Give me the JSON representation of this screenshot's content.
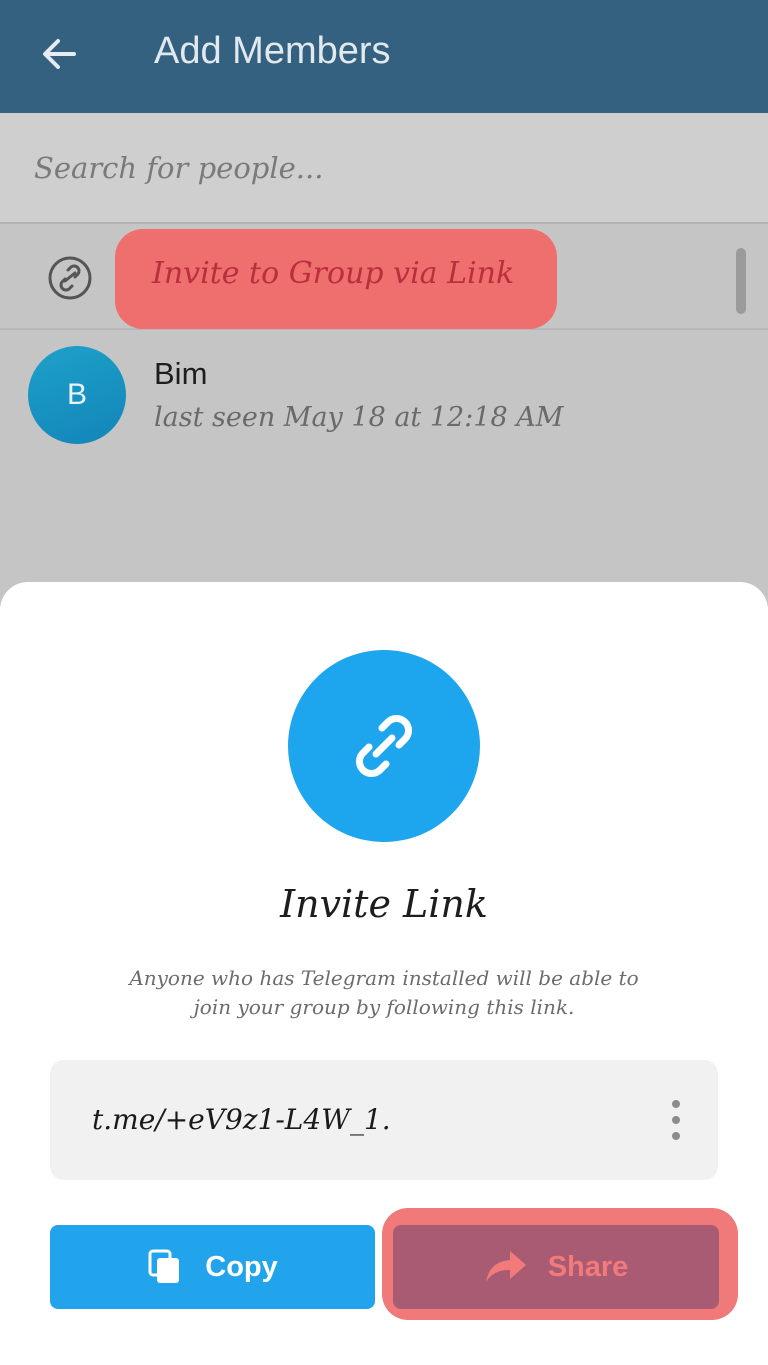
{
  "header": {
    "title": "Add Members",
    "back_icon": "arrow-left-icon"
  },
  "search": {
    "placeholder": "Search for people..."
  },
  "list": {
    "invite_label": "Invite to Group via Link",
    "invite_icon": "link-icon",
    "contacts": [
      {
        "initial": "B",
        "name": "Bim",
        "status": "last seen May 18 at 12:18 AM"
      }
    ]
  },
  "sheet": {
    "icon": "link-icon",
    "title": "Invite Link",
    "description": "Anyone who has Telegram installed will be able to join your group by following this link.",
    "link": "t.me/+eV9z1-L4W_1.",
    "more_icon": "more-vertical-icon",
    "copy_label": "Copy",
    "copy_icon": "copy-icon",
    "share_label": "Share",
    "share_icon": "share-arrow-icon"
  },
  "colors": {
    "header_bg": "#33617f",
    "accent_blue": "#1da6ee",
    "highlight_red": "#ef6e6e",
    "share_bg": "#a95b73"
  }
}
